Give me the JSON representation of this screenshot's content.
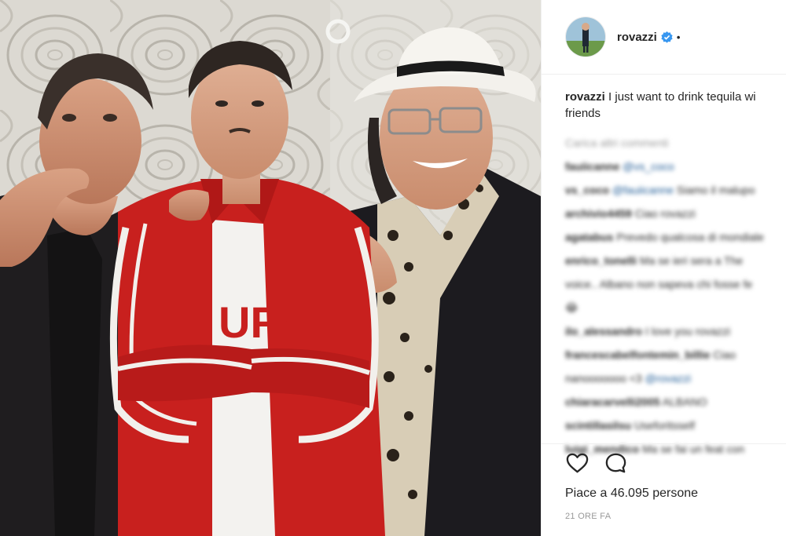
{
  "post": {
    "username": "rovazzi",
    "separator_dot": "•",
    "caption_user": "rovazzi",
    "caption_line1": "I just want to drink tequila wi",
    "caption_line2": "friends",
    "load_more": "Carica altri commenti",
    "comments": [
      {
        "user": "fauiicanne",
        "mention": "@vs_coco",
        "text": ""
      },
      {
        "user": "vs_coco",
        "mention": "@fauiicanne",
        "text": "Siamo il malupo"
      },
      {
        "user": "archivio4459",
        "mention": "",
        "text": "Ciao rovazzi"
      },
      {
        "user": "agatabus",
        "mention": "",
        "text": "Prevedo qualcosa di mondiale"
      },
      {
        "user": "enrico_tonelli",
        "mention": "",
        "text": "Ma se ieri sera a The"
      },
      {
        "user": "",
        "mention": "",
        "text": "voice.. Albano non sapeva chi fosse fe"
      },
      {
        "user": "",
        "mention": "",
        "text": "😂"
      },
      {
        "user": "ilo_alessandro",
        "mention": "",
        "text": "I love you rovazzi"
      },
      {
        "user": "francescabelfontemin_billie",
        "mention": "",
        "text": "Ciao"
      },
      {
        "user": "",
        "mention": "@rovazzi",
        "text": "nanooooooo <3"
      },
      {
        "user": "chiaracarvelli2005",
        "mention": "",
        "text": "ALBANO"
      },
      {
        "user": "scintillasilsu",
        "mention": "",
        "text": "Useforitsself"
      },
      {
        "user": "luigi_mendico",
        "mention": "",
        "text": "Ma se fai un feat con"
      }
    ],
    "likes_text": "Piace a 46.095 persone",
    "timestamp": "21 ORE FA"
  },
  "icons": {
    "verified": "verified-badge-icon",
    "like": "heart-icon",
    "comment": "comment-bubble-icon"
  },
  "colors": {
    "verified_blue": "#3897f0",
    "text": "#262626",
    "muted": "#999999",
    "jacket_red": "#c8201e"
  }
}
